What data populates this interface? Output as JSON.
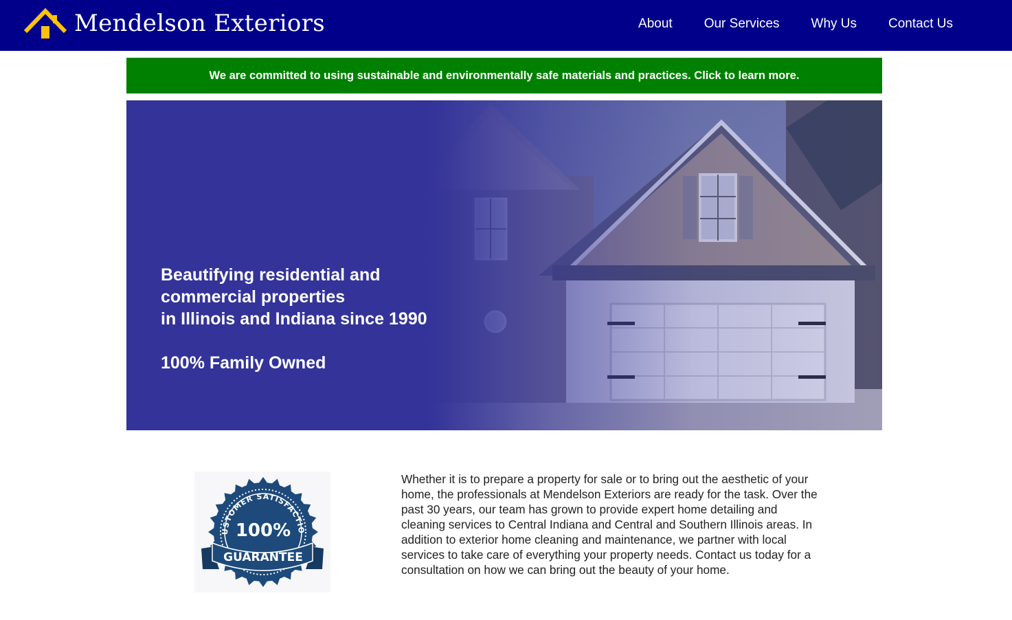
{
  "header": {
    "brand": "Mendelson Exteriors",
    "logo_icon": "house-roof-icon",
    "nav": [
      {
        "label": "About"
      },
      {
        "label": "Our Services"
      },
      {
        "label": "Why Us"
      },
      {
        "label": "Contact Us"
      }
    ]
  },
  "banner": {
    "text": "We are committed to using sustainable and environmentally safe materials and practices. Click to learn more."
  },
  "hero": {
    "lines": [
      "Beautifying residential and",
      "commercial properties",
      "in Illinois and Indiana since 1990"
    ],
    "tagline": "100% Family Owned",
    "image": "house-with-garage-image"
  },
  "guarantee_badge": {
    "top_text": "CUSTOMER SATISFACTION",
    "value": "100%",
    "ribbon": "GUARANTEE"
  },
  "about": {
    "paragraph": "Whether it is to prepare a property for sale or to bring out the aesthetic of your home, the professionals at Mendelson Exteriors are ready for the task. Over the past 30 years, our team has grown to provide expert home detailing and cleaning services to Central Indiana and Central and Southern Illinois areas. In addition to exterior home cleaning and maintenance, we partner with local services to take care of everything your property needs. Contact us today for a consultation on how we can bring out the beauty of your home."
  },
  "colors": {
    "header_bg": "#00008b",
    "banner_bg": "#008000",
    "hero_overlay": "#333399",
    "logo_accent": "#ffc20e",
    "badge_blue": "#1d4a7a"
  }
}
